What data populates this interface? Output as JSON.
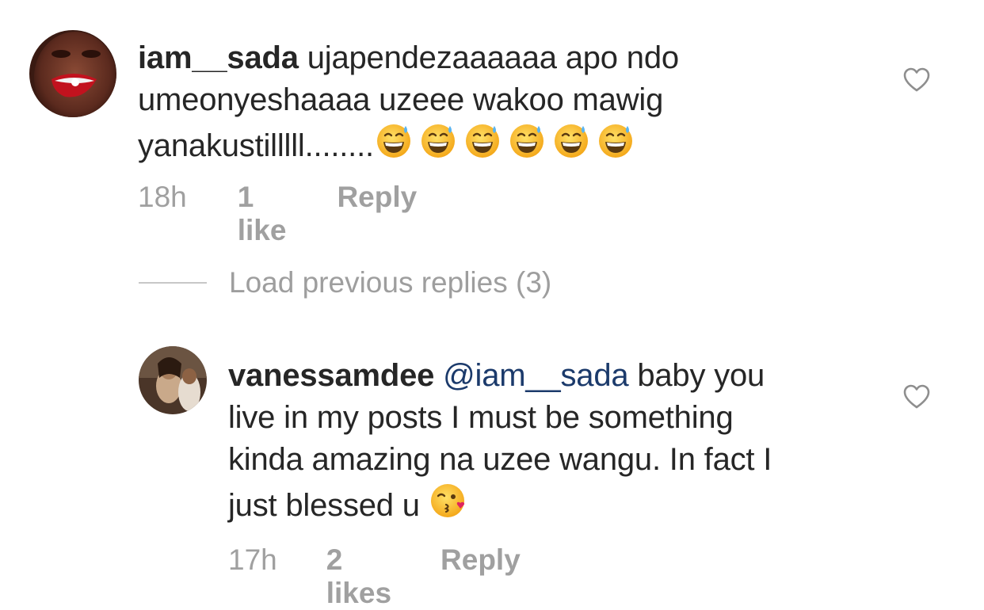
{
  "comments": [
    {
      "username": "iam__sada",
      "text_lines": [
        "ujapendezaaaaaa apo ndo",
        "umeonyeshaaaa uzeee wakoo mawig",
        "yanakustilllll........"
      ],
      "emoji_icon": "grinning-sweat-emoji",
      "emoji_count": 6,
      "time": "18h",
      "likes": "1 like",
      "reply_label": "Reply"
    },
    {
      "username": "vanessamdee",
      "mention": "@iam__sada",
      "text_first": "baby you",
      "text_lines": [
        "live in my posts I must be something",
        "kinda amazing na uzee wangu. In fact I",
        "just blessed u"
      ],
      "emoji_icon": "kissing-heart-emoji",
      "time": "17h",
      "likes": "2 likes",
      "reply_label": "Reply"
    }
  ],
  "load_previous": "Load previous replies (3)",
  "icons": {
    "like": "heart-outline-icon"
  }
}
